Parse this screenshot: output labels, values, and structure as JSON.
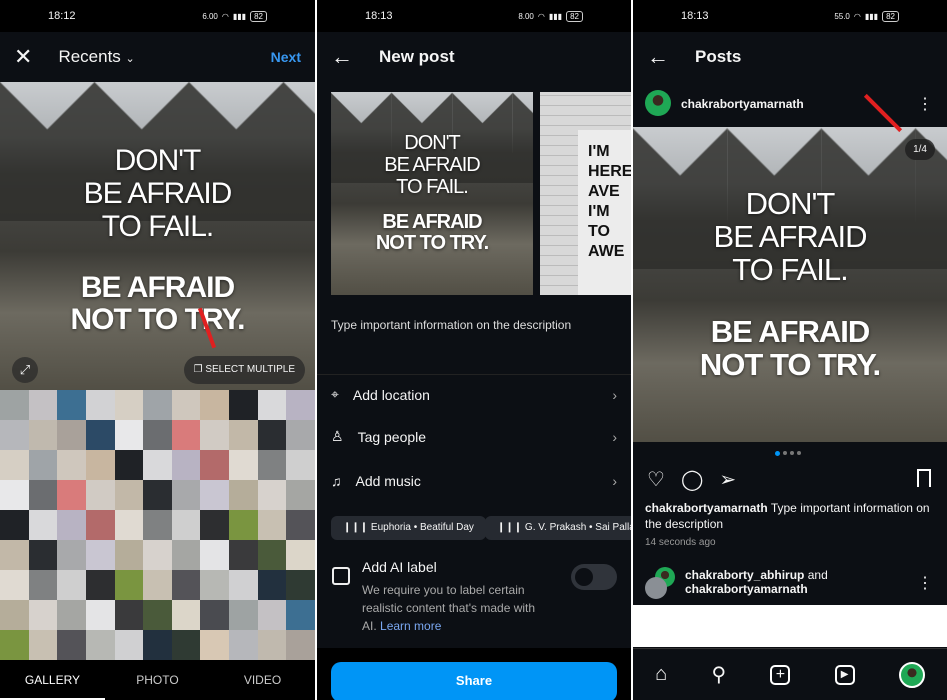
{
  "quote": {
    "line1": "DON'T",
    "line2": "BE AFRAID",
    "line3": "TO FAIL.",
    "line4": "BE AFRAID",
    "line5": "NOT TO TRY."
  },
  "screen1": {
    "time": "18:12",
    "speed": "6.00",
    "battery": "82",
    "album": "Recents",
    "next": "Next",
    "select_multiple": "SELECT MULTIPLE",
    "tabs": [
      "GALLERY",
      "PHOTO",
      "VIDEO"
    ],
    "active_tab": "GALLERY"
  },
  "screen2": {
    "time": "18:13",
    "speed": "8.00",
    "battery": "82",
    "title": "New post",
    "second_photo_lines": [
      "I'M",
      "HERE",
      "AVE",
      "I'M",
      "TO",
      "AWE"
    ],
    "description": "Type important information on the description",
    "rows": [
      "Add location",
      "Tag people",
      "Add music"
    ],
    "music_chips": [
      "Euphoria • Beatiful Day",
      "G. V. Prakash • Sai Pallavi"
    ],
    "ai_label": {
      "title": "Add AI label",
      "text": "We require you to label certain realistic content that's made with AI.",
      "link": "Learn more",
      "enabled": false
    },
    "share": "Share"
  },
  "screen3": {
    "time": "18:13",
    "speed": "55.0",
    "battery": "82",
    "title": "Posts",
    "username": "chakrabortyamarnath",
    "counter": "1/4",
    "carousel_index": 1,
    "carousel_total": 4,
    "caption_user": "chakrabortyamarnath",
    "caption": "Type important information on the description",
    "time_ago": "14 seconds ago",
    "liked_user": "chakraborty_abhirup",
    "liked_and": "and",
    "liked_user2": "chakrabortyamarnath"
  },
  "colors": {
    "accent": "#0095f6",
    "background": "#0c0f14",
    "arrow": "#e02020"
  }
}
